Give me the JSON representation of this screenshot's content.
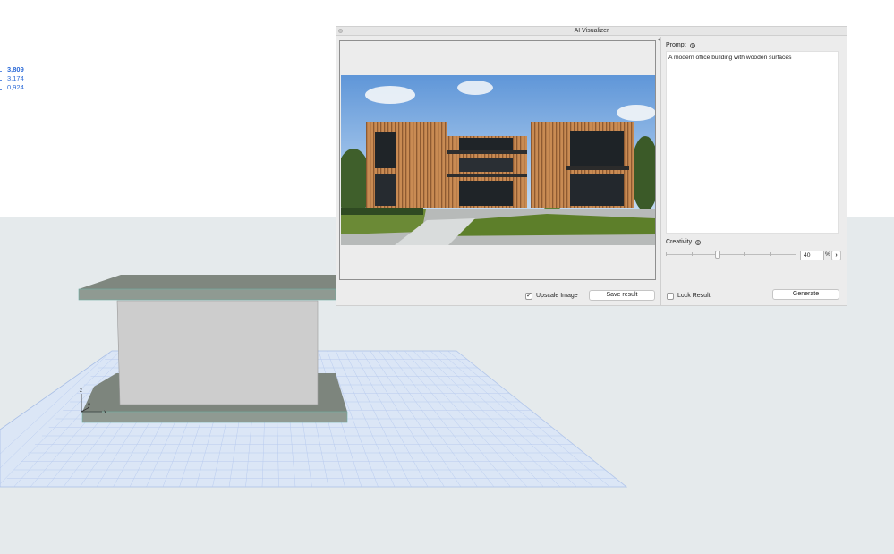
{
  "viewport": {
    "coordinates": [
      "3,809",
      "3,174",
      "0,924"
    ],
    "axis_labels": {
      "z": "z",
      "y": "y",
      "x": "x"
    },
    "colors": {
      "ground": "#e5eaec",
      "grid": "#c3d5f2",
      "slab": "#7f877f",
      "wall": "#cfcfcf",
      "coord_text": "#2d6bd8"
    }
  },
  "palette": {
    "title": "AI Visualizer",
    "prompt": {
      "label": "Prompt",
      "info_icon": "info-icon",
      "value": "A modern office building with wooden surfaces"
    },
    "creativity": {
      "label": "Creativity",
      "info_icon": "info-icon",
      "value": "40",
      "slider_fraction": 0.4,
      "unit": "%",
      "next_icon": "chevron-right-icon",
      "next_glyph": "›"
    },
    "upscale": {
      "label": "Upscale Image",
      "checked": true,
      "check_glyph": "✓"
    },
    "lock": {
      "label": "Lock Result",
      "checked": false
    },
    "save_label": "Save result",
    "generate_label": "Generate",
    "preview_image": "ai-rendered-modern-wooden-office-building"
  }
}
